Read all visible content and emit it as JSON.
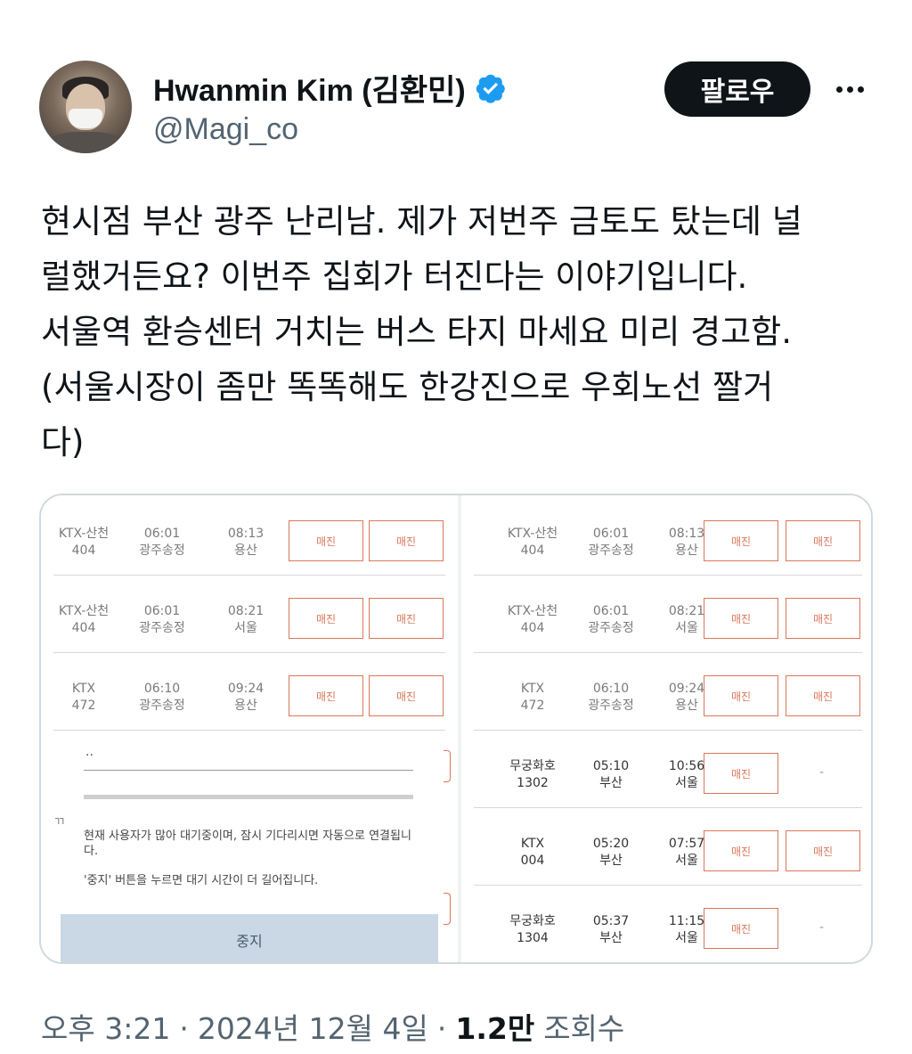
{
  "author": {
    "display_name": "Hwanmin Kim (김환민)",
    "handle": "@Magi_co",
    "verified_badge_color": "#1d9bf0"
  },
  "actions": {
    "follow_label": "팔로우",
    "more_icon": "more-horizontal-icon"
  },
  "tweet": {
    "lines": [
      "현시점 부산 광주 난리남. 제가 저번주 금토도 탔는데 널",
      "럴했거든요? 이번주 집회가 터진다는 이야기입니다.",
      "서울역 환승센터 거치는 버스 타지 마세요 미리 경고함.",
      "(서울시장이 좀만 똑똑해도 한강진으로 우회노선 짤거",
      "다)"
    ]
  },
  "media": {
    "left_rows": [
      {
        "train": "KTX-산천",
        "number": "404",
        "dep_time": "06:01",
        "dep_station": "광주송정",
        "arr_time": "08:13",
        "arr_station": "용산",
        "seat1": "매진",
        "seat2": "매진"
      },
      {
        "train": "KTX-산천",
        "number": "404",
        "dep_time": "06:01",
        "dep_station": "광주송정",
        "arr_time": "08:21",
        "arr_station": "서울",
        "seat1": "매진",
        "seat2": "매진"
      },
      {
        "train": "KTX",
        "number": "472",
        "dep_time": "06:10",
        "dep_station": "광주송정",
        "arr_time": "09:24",
        "arr_station": "용산",
        "seat1": "매진",
        "seat2": "매진"
      }
    ],
    "right_rows": [
      {
        "train": "KTX-산천",
        "number": "404",
        "dep_time": "06:01",
        "dep_station": "광주송정",
        "arr_time": "08:13",
        "arr_station": "용산",
        "seat1": "매진",
        "seat2": "매진"
      },
      {
        "train": "KTX-산천",
        "number": "404",
        "dep_time": "06:01",
        "dep_station": "광주송정",
        "arr_time": "08:21",
        "arr_station": "서울",
        "seat1": "매진",
        "seat2": "매진"
      },
      {
        "train": "KTX",
        "number": "472",
        "dep_time": "06:10",
        "dep_station": "광주송정",
        "arr_time": "09:24",
        "arr_station": "용산",
        "seat1": "매진",
        "seat2": "매진"
      },
      {
        "train": "무궁화호",
        "number": "1302",
        "dep_time": "05:10",
        "dep_station": "부산",
        "arr_time": "10:56",
        "arr_station": "서울",
        "seat1": "매진",
        "seat2": "-"
      },
      {
        "train": "KTX",
        "number": "004",
        "dep_time": "05:20",
        "dep_station": "부산",
        "arr_time": "07:57",
        "arr_station": "서울",
        "seat1": "매진",
        "seat2": "매진"
      },
      {
        "train": "무궁화호",
        "number": "1304",
        "dep_time": "05:37",
        "dep_station": "부산",
        "arr_time": "11:15",
        "arr_station": "서울",
        "seat1": "매진",
        "seat2": "-"
      }
    ],
    "dialog": {
      "field_text": "..",
      "message_1": "현재 사용자가 많아 대기중이며, 잠시 기다리시면 자동으로 연결됩니다.",
      "message_2": "'중지' 버튼을 누르면 대기 시간이 더 길어집니다.",
      "stop_label": "중지",
      "side_char": "ㄲ"
    }
  },
  "meta": {
    "time": "오후 3:21",
    "date": "2024년 12월 4일",
    "separator": "·",
    "views": "1.2만",
    "views_label": "조회수"
  }
}
